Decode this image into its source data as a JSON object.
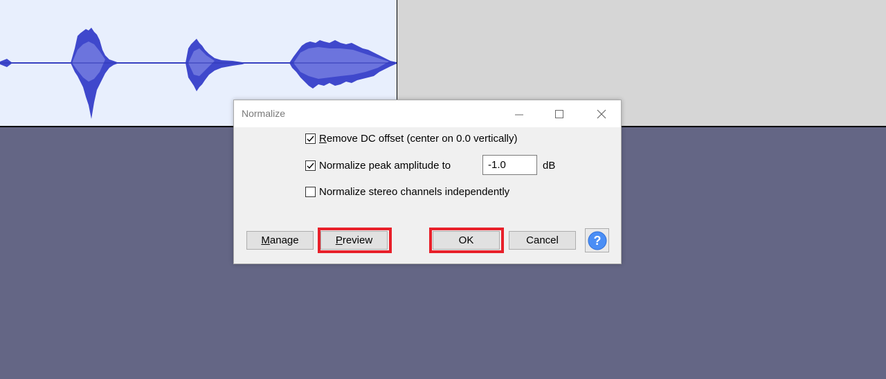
{
  "dialog": {
    "title": "Normalize",
    "options": [
      {
        "label": "Remove DC offset (center on 0.0 vertically)",
        "checked": true,
        "mnemonic": "R"
      },
      {
        "label": "Normalize peak amplitude to",
        "checked": true
      },
      {
        "label": "Normalize stereo channels independently",
        "checked": false
      }
    ],
    "peak_amplitude_value": "-1.0",
    "peak_amplitude_unit": "dB",
    "buttons": {
      "manage_label": "Manage",
      "preview_label": "Preview",
      "ok_label": "OK",
      "cancel_label": "Cancel",
      "help_icon": "help-question-icon"
    }
  },
  "colors": {
    "waveform": "#3f48cc",
    "waveform_bg": "#e8effd",
    "empty_track_bg": "#d6d6d6",
    "workspace_bg": "#646685",
    "highlight": "#e8202a",
    "help_icon": "#4a8ef5"
  }
}
